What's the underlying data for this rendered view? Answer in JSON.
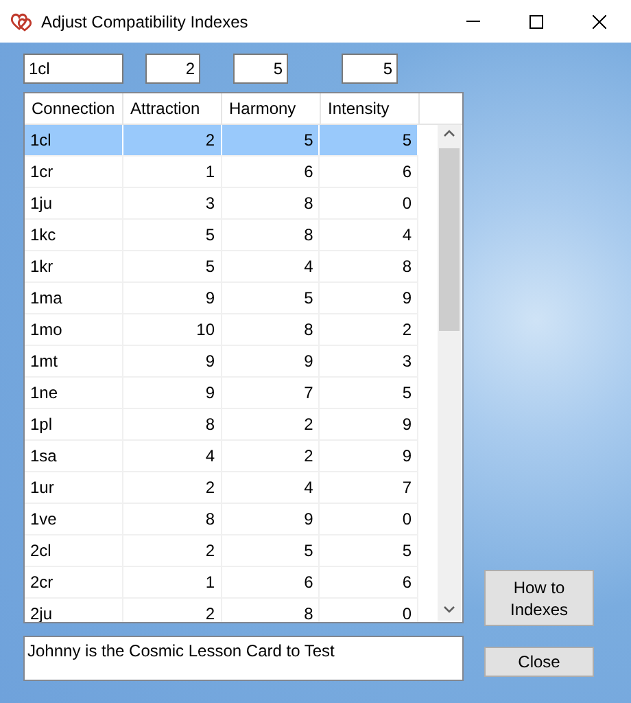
{
  "window": {
    "title": "Adjust Compatibility Indexes"
  },
  "fields": [
    "1cl",
    "2",
    "5",
    "5"
  ],
  "table": {
    "columns": [
      "Connection",
      "Attraction",
      "Harmony",
      "Intensity"
    ],
    "rows": [
      {
        "cells": [
          "1cl",
          "2",
          "5",
          "5"
        ],
        "selected": true
      },
      {
        "cells": [
          "1cr",
          "1",
          "6",
          "6"
        ],
        "selected": false
      },
      {
        "cells": [
          "1ju",
          "3",
          "8",
          "0"
        ],
        "selected": false
      },
      {
        "cells": [
          "1kc",
          "5",
          "8",
          "4"
        ],
        "selected": false
      },
      {
        "cells": [
          "1kr",
          "5",
          "4",
          "8"
        ],
        "selected": false
      },
      {
        "cells": [
          "1ma",
          "9",
          "5",
          "9"
        ],
        "selected": false
      },
      {
        "cells": [
          "1mo",
          "10",
          "8",
          "2"
        ],
        "selected": false
      },
      {
        "cells": [
          "1mt",
          "9",
          "9",
          "3"
        ],
        "selected": false
      },
      {
        "cells": [
          "1ne",
          "9",
          "7",
          "5"
        ],
        "selected": false
      },
      {
        "cells": [
          "1pl",
          "8",
          "2",
          "9"
        ],
        "selected": false
      },
      {
        "cells": [
          "1sa",
          "4",
          "2",
          "9"
        ],
        "selected": false
      },
      {
        "cells": [
          "1ur",
          "2",
          "4",
          "7"
        ],
        "selected": false
      },
      {
        "cells": [
          "1ve",
          "8",
          "9",
          "0"
        ],
        "selected": false
      },
      {
        "cells": [
          "2cl",
          "2",
          "5",
          "5"
        ],
        "selected": false
      },
      {
        "cells": [
          "2cr",
          "1",
          "6",
          "6"
        ],
        "selected": false
      },
      {
        "cells": [
          "2ju",
          "2",
          "8",
          "0"
        ],
        "selected": false
      }
    ]
  },
  "message": "Johnny is the Cosmic Lesson Card to Test",
  "buttons": [
    "How to Indexes",
    "Close"
  ]
}
